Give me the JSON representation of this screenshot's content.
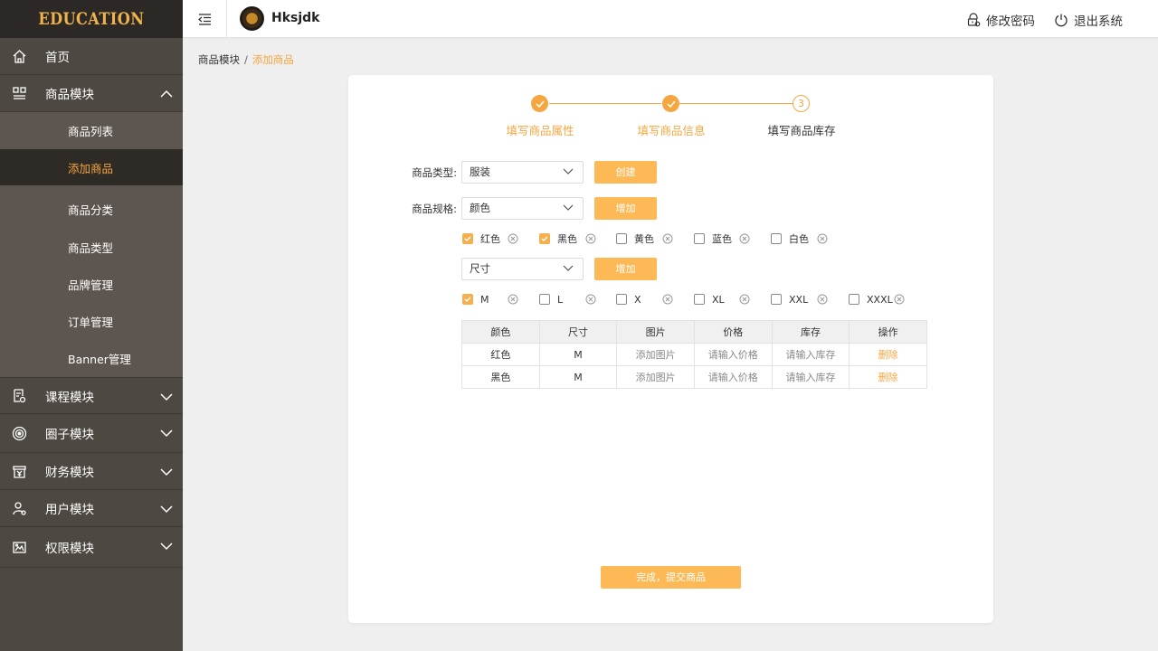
{
  "sidebar": {
    "logo": "EDUCATION",
    "items": [
      {
        "label": "首页"
      },
      {
        "label": "商品模块"
      },
      {
        "label": "课程模块"
      },
      {
        "label": "圈子模块"
      },
      {
        "label": "财务模块"
      },
      {
        "label": "用户模块"
      },
      {
        "label": "权限模块"
      }
    ],
    "sub_items": [
      {
        "label": "商品列表"
      },
      {
        "label": "添加商品"
      },
      {
        "label": "商品分类"
      },
      {
        "label": "商品类型"
      },
      {
        "label": "品牌管理"
      },
      {
        "label": "订单管理"
      },
      {
        "label": "Banner管理"
      }
    ]
  },
  "header": {
    "username": "Hksjdk",
    "change_password": "修改密码",
    "logout": "退出系统"
  },
  "breadcrumb": {
    "parent": "商品模块",
    "separator": "/",
    "current": "添加商品"
  },
  "steps": {
    "items": [
      {
        "label": "填写商品属性",
        "state": "done"
      },
      {
        "label": "填写商品信息",
        "state": "done"
      },
      {
        "label": "填写商品库存",
        "state": "current",
        "number": "3"
      }
    ]
  },
  "form": {
    "type_label": "商品类型:",
    "type_value": "服装",
    "create_btn": "创建",
    "spec_label": "商品规格:",
    "spec_value": "颜色",
    "add_btn": "增加",
    "size_value": "尺寸",
    "add_btn2": "增加",
    "colors": [
      {
        "label": "红色",
        "checked": true
      },
      {
        "label": "黑色",
        "checked": true
      },
      {
        "label": "黄色",
        "checked": false
      },
      {
        "label": "蓝色",
        "checked": false
      },
      {
        "label": "白色",
        "checked": false
      }
    ],
    "sizes": [
      {
        "label": "M",
        "checked": true
      },
      {
        "label": "L",
        "checked": false
      },
      {
        "label": "X",
        "checked": false
      },
      {
        "label": "XL",
        "checked": false
      },
      {
        "label": "XXL",
        "checked": false
      },
      {
        "label": "XXXL",
        "checked": false
      }
    ]
  },
  "table": {
    "headers": [
      "颜色",
      "尺寸",
      "图片",
      "价格",
      "库存",
      "操作"
    ],
    "rows": [
      [
        "红色",
        "M",
        "添加图片",
        "请输入价格",
        "请输入库存",
        "删除"
      ],
      [
        "黑色",
        "M",
        "添加图片",
        "请输入价格",
        "请输入库存",
        "删除"
      ]
    ]
  },
  "submit_label": "完成，提交商品",
  "colors": {
    "accent": "#f5a640",
    "button": "#fdb955",
    "sidebar": "#4e4842",
    "sidebar_active": "#2e2a26"
  }
}
